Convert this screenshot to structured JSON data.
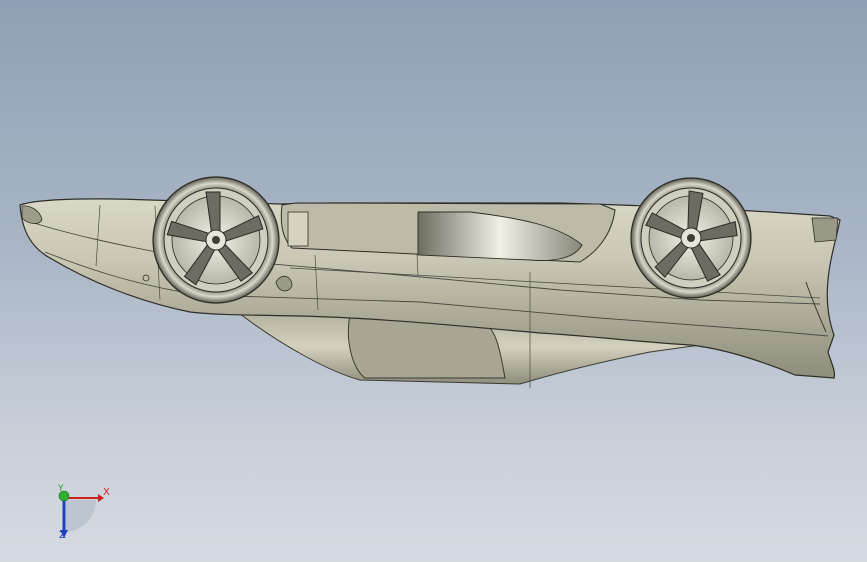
{
  "viewport": {
    "background_top": "#8fa0b5",
    "background_bottom": "#d6dbe2",
    "model_name": "car-body-inverted"
  },
  "triad": {
    "x_label": "X",
    "y_label": "Y",
    "z_label": "Z",
    "x_color": "#d02020",
    "y_color": "#20a020",
    "z_color": "#2040c0"
  },
  "icons": {
    "model": "car-model-icon",
    "wheel": "wheel-icon",
    "triad": "axis-triad-icon"
  }
}
